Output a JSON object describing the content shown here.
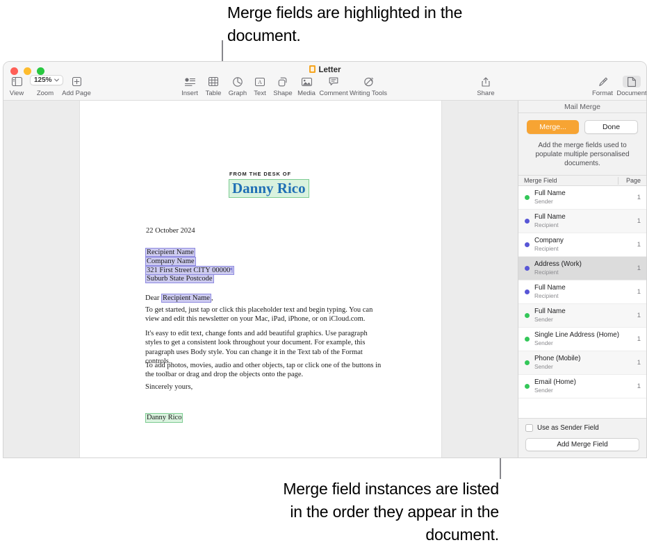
{
  "annotations": {
    "top": "Merge fields are highlighted in the document.",
    "bottom": "Merge field instances are listed in the order they appear in the document."
  },
  "window": {
    "title": "Letter"
  },
  "toolbar": {
    "view_label": "View",
    "zoom_label": "Zoom",
    "zoom_value": "125%",
    "add_page_label": "Add Page",
    "insert_label": "Insert",
    "table_label": "Table",
    "graph_label": "Graph",
    "text_label": "Text",
    "shape_label": "Shape",
    "media_label": "Media",
    "comment_label": "Comment",
    "writing_tools_label": "Writing Tools",
    "share_label": "Share",
    "format_label": "Format",
    "document_label": "Document"
  },
  "document": {
    "desk_of": "FROM THE DESK OF",
    "sender_name": "Danny Rico",
    "date": "22 October 2024",
    "address": [
      "Recipient Name",
      "Company Name",
      "321 First Street CITY 00000",
      "Suburb State Postcode"
    ],
    "salutation_prefix": "Dear ",
    "salutation_field": "Recipient Name",
    "salutation_suffix": ",",
    "paragraphs": [
      "To get started, just tap or click this placeholder text and begin typing. You can view and edit this newsletter on your Mac, iPad, iPhone, or on iCloud.com.",
      "It's easy to edit text, change fonts and add beautiful graphics. Use paragraph styles to get a consistent look throughout your document. For example, this paragraph uses Body style. You can change it in the Text tab of the Format controls.",
      "To add photos, movies, audio and other objects, tap or click one of the buttons in the toolbar or drag and drop the objects onto the page."
    ],
    "signoff": "Sincerely yours,",
    "signature": "Danny Rico"
  },
  "sidebar": {
    "title": "Mail Merge",
    "merge_button": "Merge...",
    "done_button": "Done",
    "description": "Add the merge fields used to populate multiple personalised documents.",
    "list_header": {
      "field": "Merge Field",
      "page": "Page"
    },
    "fields": [
      {
        "name": "Full Name",
        "source": "Sender",
        "page": "1",
        "dot": "#34c759",
        "selected": false
      },
      {
        "name": "Full Name",
        "source": "Recipient",
        "page": "1",
        "dot": "#5856d6",
        "selected": false
      },
      {
        "name": "Company",
        "source": "Recipient",
        "page": "1",
        "dot": "#5856d6",
        "selected": false
      },
      {
        "name": "Address (Work)",
        "source": "Recipient",
        "page": "1",
        "dot": "#5856d6",
        "selected": true
      },
      {
        "name": "Full Name",
        "source": "Recipient",
        "page": "1",
        "dot": "#5856d6",
        "selected": false
      },
      {
        "name": "Full Name",
        "source": "Sender",
        "page": "1",
        "dot": "#34c759",
        "selected": false
      },
      {
        "name": "Single Line Address (Home)",
        "source": "Sender",
        "page": "1",
        "dot": "#34c759",
        "selected": false
      },
      {
        "name": "Phone (Mobile)",
        "source": "Sender",
        "page": "1",
        "dot": "#34c759",
        "selected": false
      },
      {
        "name": "Email (Home)",
        "source": "Sender",
        "page": "1",
        "dot": "#34c759",
        "selected": false
      }
    ],
    "use_as_sender_field": "Use as Sender Field",
    "add_merge_field": "Add Merge Field"
  },
  "colors": {
    "merge_accent": "#f7a433",
    "sender_dot": "#34c759",
    "recipient_dot": "#5856d6",
    "sender_highlight": "#d9f2de",
    "recipient_highlight": "#cdcbf0",
    "sender_name_text": "#1f6fb5"
  }
}
